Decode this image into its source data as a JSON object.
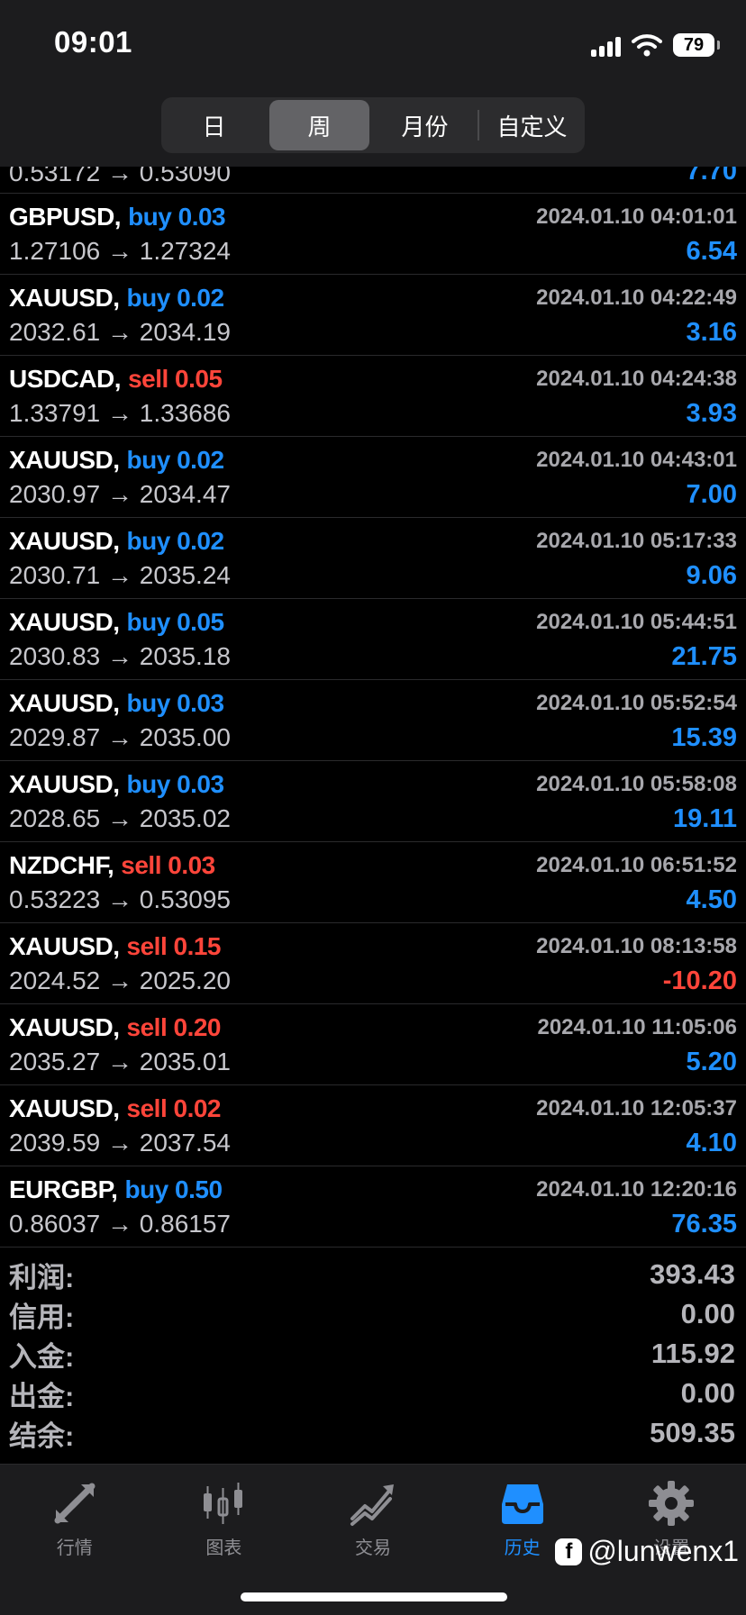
{
  "status_bar": {
    "time": "09:01",
    "battery": "79"
  },
  "period_tabs": [
    {
      "label": "日",
      "active": false
    },
    {
      "label": "周",
      "active": true
    },
    {
      "label": "月份",
      "active": false
    },
    {
      "label": "自定义",
      "active": false
    }
  ],
  "partial_row": {
    "prices": "0.53172 → 0.53090",
    "profit": "7.70"
  },
  "trades": [
    {
      "symbol": "GBPUSD,",
      "action": "buy 0.03",
      "side": "buy",
      "time": "2024.01.10 04:01:01",
      "prices": "1.27106 → 1.27324",
      "profit": "6.54"
    },
    {
      "symbol": "XAUUSD,",
      "action": "buy 0.02",
      "side": "buy",
      "time": "2024.01.10 04:22:49",
      "prices": "2032.61 → 2034.19",
      "profit": "3.16"
    },
    {
      "symbol": "USDCAD,",
      "action": "sell 0.05",
      "side": "sell",
      "time": "2024.01.10 04:24:38",
      "prices": "1.33791 → 1.33686",
      "profit": "3.93"
    },
    {
      "symbol": "XAUUSD,",
      "action": "buy 0.02",
      "side": "buy",
      "time": "2024.01.10 04:43:01",
      "prices": "2030.97 → 2034.47",
      "profit": "7.00"
    },
    {
      "symbol": "XAUUSD,",
      "action": "buy 0.02",
      "side": "buy",
      "time": "2024.01.10 05:17:33",
      "prices": "2030.71 → 2035.24",
      "profit": "9.06"
    },
    {
      "symbol": "XAUUSD,",
      "action": "buy 0.05",
      "side": "buy",
      "time": "2024.01.10 05:44:51",
      "prices": "2030.83 → 2035.18",
      "profit": "21.75"
    },
    {
      "symbol": "XAUUSD,",
      "action": "buy 0.03",
      "side": "buy",
      "time": "2024.01.10 05:52:54",
      "prices": "2029.87 → 2035.00",
      "profit": "15.39"
    },
    {
      "symbol": "XAUUSD,",
      "action": "buy 0.03",
      "side": "buy",
      "time": "2024.01.10 05:58:08",
      "prices": "2028.65 → 2035.02",
      "profit": "19.11"
    },
    {
      "symbol": "NZDCHF,",
      "action": "sell 0.03",
      "side": "sell",
      "time": "2024.01.10 06:51:52",
      "prices": "0.53223 → 0.53095",
      "profit": "4.50"
    },
    {
      "symbol": "XAUUSD,",
      "action": "sell 0.15",
      "side": "sell",
      "time": "2024.01.10 08:13:58",
      "prices": "2024.52 → 2025.20",
      "profit": "-10.20"
    },
    {
      "symbol": "XAUUSD,",
      "action": "sell 0.20",
      "side": "sell",
      "time": "2024.01.10 11:05:06",
      "prices": "2035.27 → 2035.01",
      "profit": "5.20"
    },
    {
      "symbol": "XAUUSD,",
      "action": "sell 0.02",
      "side": "sell",
      "time": "2024.01.10 12:05:37",
      "prices": "2039.59 → 2037.54",
      "profit": "4.10"
    },
    {
      "symbol": "EURGBP,",
      "action": "buy 0.50",
      "side": "buy",
      "time": "2024.01.10 12:20:16",
      "prices": "0.86037 → 0.86157",
      "profit": "76.35"
    }
  ],
  "summary": [
    {
      "label": "利润:",
      "value": "393.43"
    },
    {
      "label": "信用:",
      "value": "0.00"
    },
    {
      "label": "入金:",
      "value": "115.92"
    },
    {
      "label": "出金:",
      "value": "0.00"
    },
    {
      "label": "结余:",
      "value": "509.35"
    }
  ],
  "tab_bar": [
    {
      "label": "行情",
      "icon": "quotes-arrows-icon",
      "active": false
    },
    {
      "label": "图表",
      "icon": "candlestick-chart-icon",
      "active": false
    },
    {
      "label": "交易",
      "icon": "trade-trend-icon",
      "active": false
    },
    {
      "label": "历史",
      "icon": "history-inbox-icon",
      "active": true
    },
    {
      "label": "设置",
      "icon": "gear-icon",
      "active": false
    }
  ],
  "watermark": {
    "text": "@lunwenx1",
    "icon": "facebook-icon"
  },
  "colors": {
    "buy": "#1f8fff",
    "sell": "#ff453a",
    "active_tab": "#1f8fff",
    "inactive_tab": "#8e8e93"
  }
}
